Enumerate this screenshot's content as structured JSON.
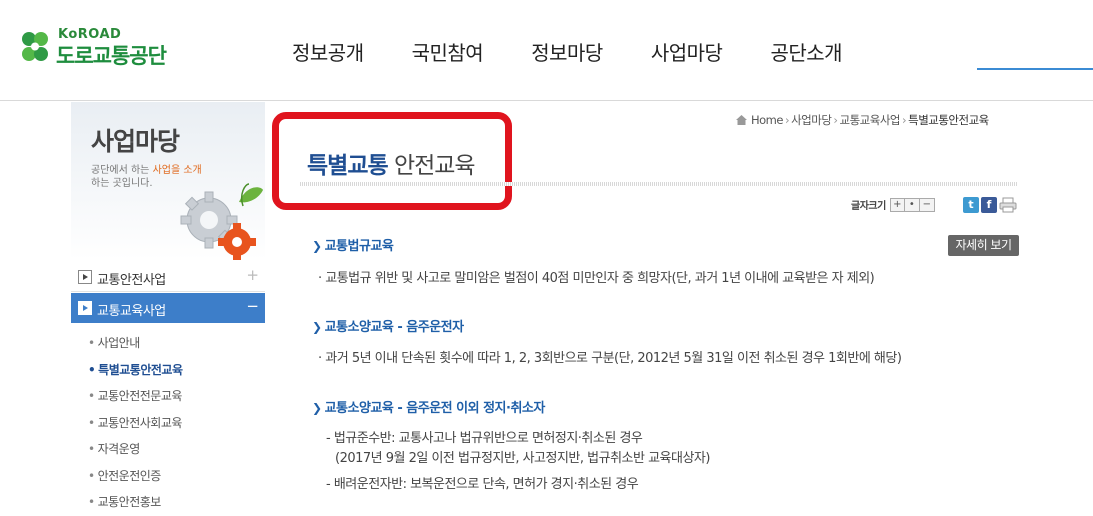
{
  "header": {
    "logo_en": "KoROAD",
    "logo_ko": "도로교통공단",
    "nav": [
      "정보공개",
      "국민참여",
      "정보마당",
      "사업마당",
      "공단소개"
    ]
  },
  "sidebar": {
    "banner_title": "사업마당",
    "banner_desc_pre": "공단에서 하는 ",
    "banner_desc_hl": "사업을 소개",
    "banner_desc_post": "하는 곳입니다.",
    "menu": [
      {
        "label": "교통안전사업",
        "sign": "+"
      },
      {
        "label": "교통교육사업",
        "sign": "−"
      }
    ],
    "submenu": [
      "사업안내",
      "특별교통안전교육",
      "교통안전전문교육",
      "교통안전사회교육",
      "자격운영",
      "안전운전인증",
      "교통안전홍보"
    ],
    "submenu_active_index": 1
  },
  "breadcrumb": [
    "Home",
    "사업마당",
    "교통교육사업",
    "특별교통안전교육"
  ],
  "page": {
    "title_highlight": "특별교통",
    "title_rest": " 안전교육",
    "fontsize_label": "글자크기",
    "fontsize_plus": "+",
    "fontsize_dot": "•",
    "fontsize_minus": "−",
    "twitter": "t",
    "facebook": "f",
    "detail_button": "자세히 보기"
  },
  "sections": [
    {
      "title": "교통법규교육",
      "lines": [
        "· 교통법규 위반 및 사고로 말미암은 벌점이 40점 미만인자 중 희망자(단, 과거 1년 이내에 교육받은 자 제외)"
      ]
    },
    {
      "title": "교통소양교육 - 음주운전자",
      "lines": [
        "· 과거 5년 이내 단속된 횟수에 따라 1, 2, 3회반으로 구분(단, 2012년 5월 31일 이전 취소된 경우 1회반에 해당)"
      ]
    },
    {
      "title": "교통소양교육 - 음주운전 이외 정지·취소자",
      "lines": [
        "- 법규준수반: 교통사고나 법규위반으로 면허정지·취소된 경우",
        "(2017년 9월 2일 이전 법규정지반, 사고정지반, 법규취소반 교육대상자)",
        "- 배려운전자반: 보복운전으로 단속, 면허가 경지·취소된 경우"
      ]
    }
  ],
  "colors": {
    "accent_blue": "#1f4e92",
    "menu_active_bg": "#3d7ec9",
    "highlight_red": "#e0141e",
    "logo_green": "#1e8d3e"
  }
}
